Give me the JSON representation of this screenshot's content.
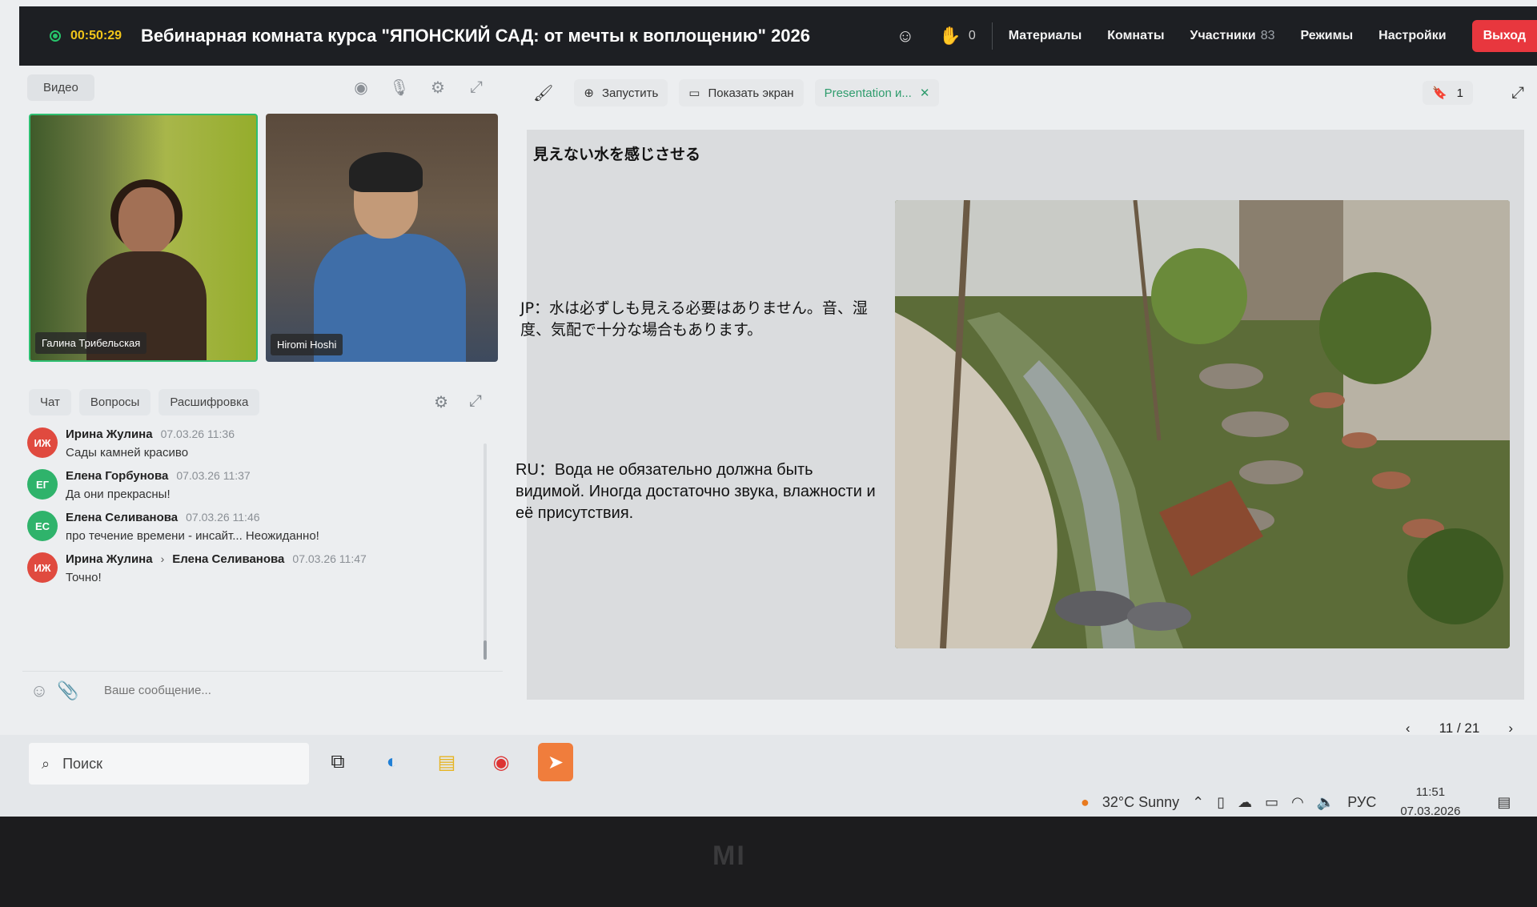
{
  "header": {
    "timer": "00:50:29",
    "title": "Вебинарная комната курса \"ЯПОНСКИЙ САД: от мечты к воплощению\" 2026",
    "hand_count": "0",
    "nav": {
      "materials": "Материалы",
      "rooms": "Комнаты",
      "participants": "Участники",
      "participants_count": "83",
      "modes": "Режимы",
      "settings": "Настройки",
      "exit": "Выход"
    }
  },
  "video": {
    "label": "Видео",
    "tiles": [
      {
        "name": "Галина Трибельская"
      },
      {
        "name": "Hiromi  Hoshi"
      }
    ]
  },
  "chat": {
    "tabs": [
      "Чат",
      "Вопросы",
      "Расшифровка"
    ],
    "messages": [
      {
        "initials": "ИЖ",
        "author": "Ирина Жулина",
        "time": "07.03.26 11:36",
        "text": "Сады камней красиво",
        "color": "#e04a3f"
      },
      {
        "initials": "ЕГ",
        "author": "Елена Горбунова",
        "time": "07.03.26 11:37",
        "text": "Да они прекрасны!",
        "color": "#2fb36b"
      },
      {
        "initials": "ЕС",
        "author": "Елена Селиванова",
        "time": "07.03.26 11:46",
        "text": "про течение времени - инсайт... Неожиданно!",
        "color": "#2fb36b"
      },
      {
        "initials": "ИЖ",
        "author": "Ирина Жулина",
        "recipient": "Елена Селиванова",
        "time": "07.03.26 11:47",
        "text": "Точно!",
        "color": "#e04a3f"
      }
    ],
    "composer_placeholder": "Ваше сообщение..."
  },
  "presentation": {
    "launch": "Запустить",
    "share_screen": "Показать экран",
    "tab_title": "Presentation и...",
    "bookmark_count": "1",
    "slide": {
      "title": "見えない水を感じさせる",
      "jp_text": "JP：水は必ずしも見える必要はありません。音、湿度、気配で十分な場合もあります。",
      "ru_text": "RU：Вода не обязательно должна быть видимой. Иногда достаточно звука, влажности и её присутствия."
    },
    "page": "11 / 21"
  },
  "taskbar": {
    "search": "Поиск",
    "weather": "32°C  Sunny",
    "lang": "РУС",
    "time": "11:51",
    "date": "07.03.2026"
  },
  "bezel": {
    "brand": "MI"
  }
}
